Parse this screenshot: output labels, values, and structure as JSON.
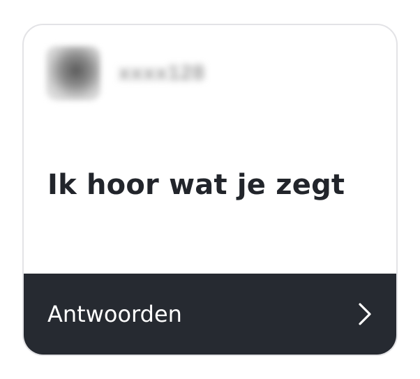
{
  "card": {
    "author": {
      "username": "xxxx128"
    },
    "message": "Ik hoor wat je zegt",
    "reply_button": {
      "label": "Antwoorden",
      "icon": "chevron-right-icon"
    }
  },
  "colors": {
    "text": "#22252b",
    "footer_bg": "#262a31",
    "footer_text": "#ffffff",
    "border": "#e3e3e6"
  }
}
